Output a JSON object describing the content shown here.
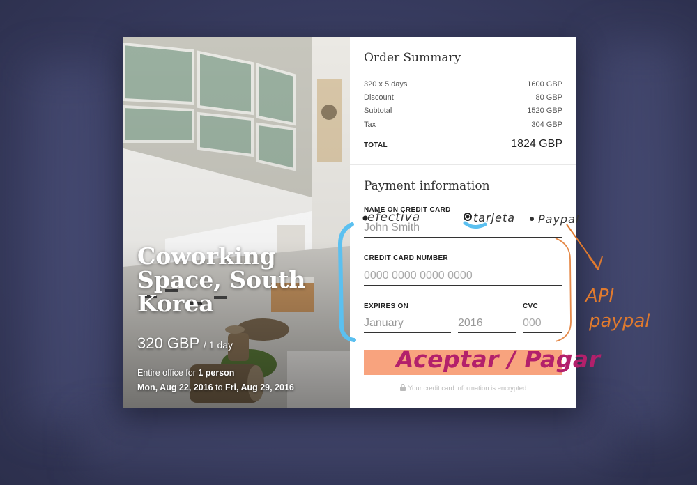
{
  "hero": {
    "title": "Coworking Space, South Korea",
    "price": "320 GBP",
    "price_unit": "/ 1 day",
    "office_prefix": "Entire office for",
    "office_people": "1 person",
    "date_from": "Mon, Aug 22, 2016",
    "date_to_word": "to",
    "date_to": "Fri, Aug 29, 2016"
  },
  "order_summary": {
    "heading": "Order Summary",
    "rows": [
      {
        "label": "320 x 5 days",
        "value": "1600 GBP"
      },
      {
        "label": "Discount",
        "value": "80 GBP"
      },
      {
        "label": "Subtotal",
        "value": "1520 GBP"
      },
      {
        "label": "Tax",
        "value": "304 GBP"
      }
    ],
    "total_label": "TOTAL",
    "total_value": "1824 GBP"
  },
  "payment": {
    "heading": "Payment information",
    "name_label": "NAME ON CREDIT CARD",
    "name_value": "John Smith",
    "card_label": "CREDIT CARD NUMBER",
    "card_placeholder": "0000 0000 0000 0000",
    "expires_label": "EXPIRES ON",
    "month_value": "January",
    "year_value": "2016",
    "cvc_label": "CVC",
    "cvc_placeholder": "000",
    "secure_note": "Your credit card information is encrypted"
  },
  "annotations": {
    "efectivo": "efectiva",
    "tarjeta": "tarjeta",
    "paypal": "Paypal",
    "api_line1": "API",
    "api_line2": "paypal",
    "aceptar": "Aceptar / Pagar"
  },
  "colors": {
    "button": "#f8a37e",
    "annotation_blue": "#5bc0f0",
    "annotation_orange": "#e07a2e",
    "annotation_magenta": "#b3206b"
  }
}
